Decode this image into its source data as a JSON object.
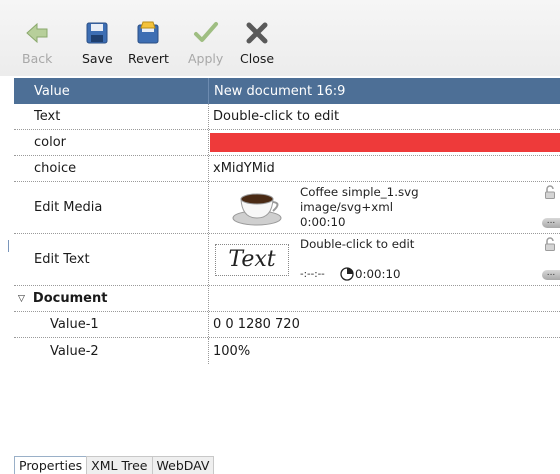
{
  "toolbar": {
    "back_label": "Back",
    "save_label": "Save",
    "revert_label": "Revert",
    "apply_label": "Apply",
    "close_label": "Close"
  },
  "grid": {
    "header": {
      "left": "Value",
      "right": "New document 16:9"
    },
    "rows": [
      {
        "label": "Text",
        "value": "Double-click to edit"
      },
      {
        "label": "color",
        "value_color": "#ee3a3a"
      },
      {
        "label": "choice",
        "value": "xMidYMid"
      }
    ],
    "media": {
      "label": "Edit Media",
      "filename": "Coffee simple_1.svg",
      "mime": "image/svg+xml",
      "duration": "0:00:10",
      "icons": [
        "coffee-cup-icon",
        "lock-icon",
        "more-icon"
      ]
    },
    "edit_text": {
      "label": "Edit Text",
      "preview": "Text",
      "caption": "Double-click to edit",
      "start": "-:--:--",
      "duration": "0:00:10",
      "icons": [
        "clock-icon",
        "lock-icon",
        "more-icon"
      ]
    },
    "section": {
      "label": "Document",
      "rows": [
        {
          "label": "Value-1",
          "value": "0 0 1280 720"
        },
        {
          "label": "Value-2",
          "value": "100%"
        }
      ]
    }
  },
  "tabs": [
    "Properties",
    "XML Tree",
    "WebDAV"
  ],
  "colors": {
    "header_bg": "#4d6f96",
    "accent_red": "#ee3a3a"
  }
}
